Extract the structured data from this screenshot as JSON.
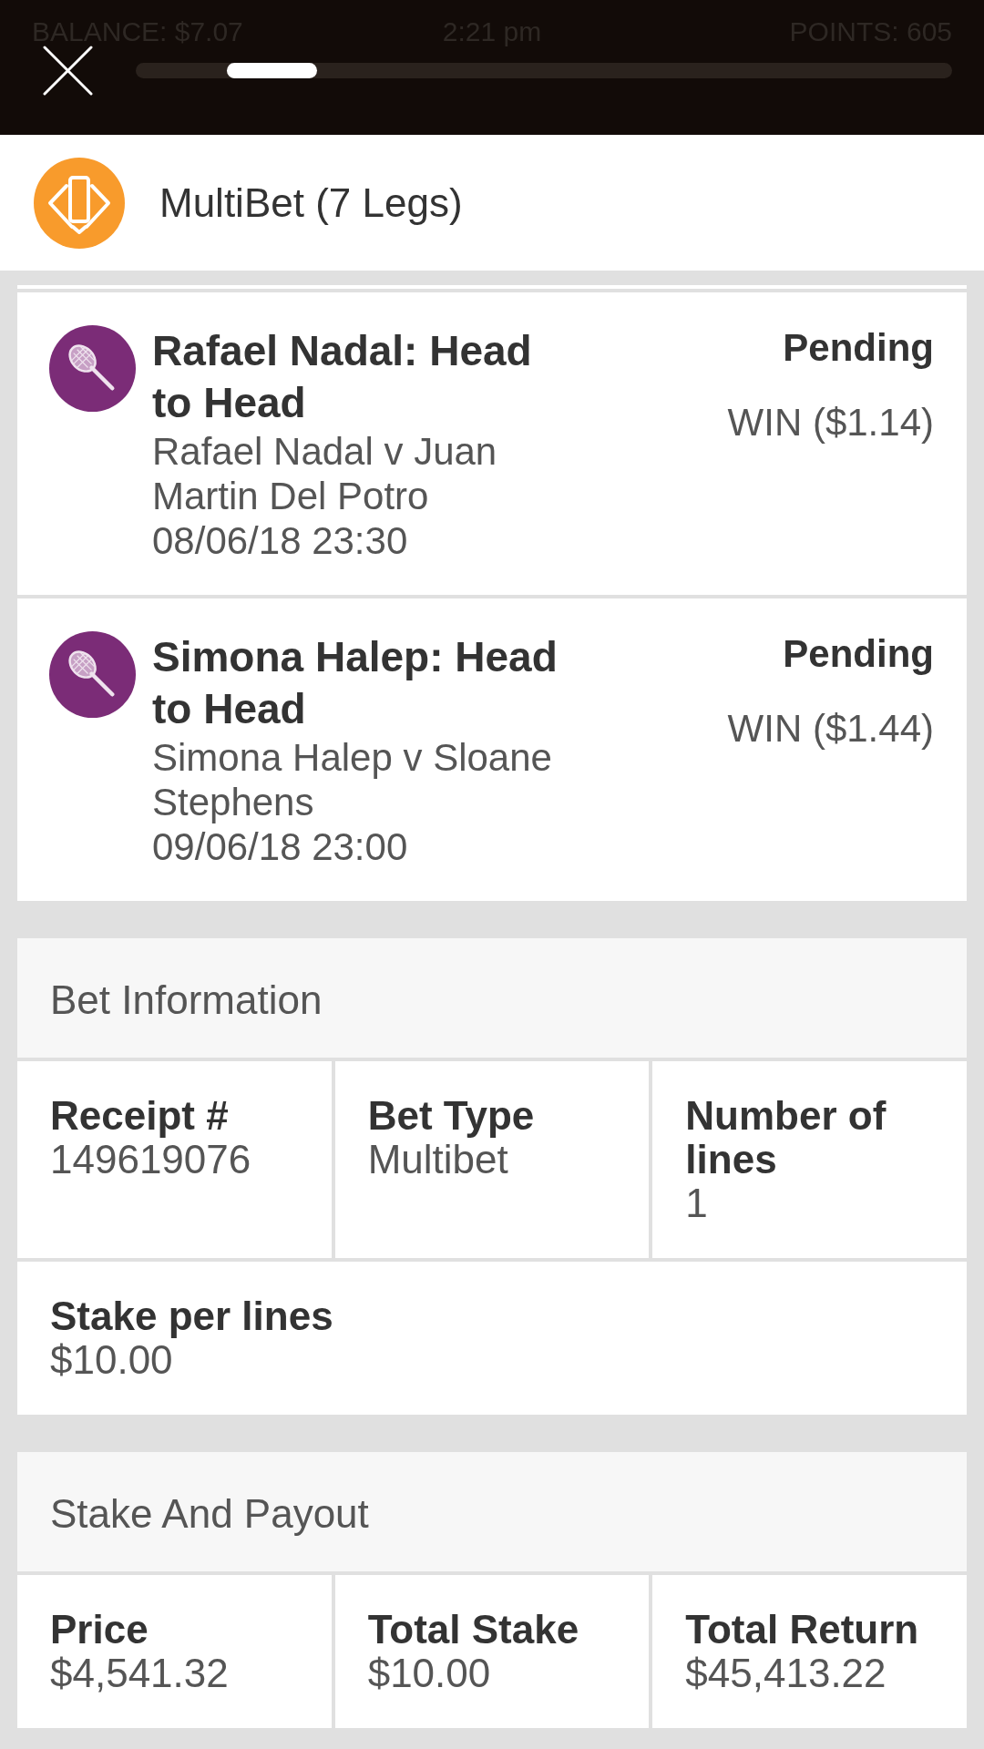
{
  "status_bar": {
    "balance": "BALANCE: $7.07",
    "time": "2:21 pm",
    "points": "POINTS: 605"
  },
  "sheet": {
    "title": "MultiBet (7 Legs)"
  },
  "legs": [
    {
      "title": "Rafael Nadal: Head to Head",
      "event": "Rafael Nadal v Juan Martin Del Potro",
      "date": "08/06/18 23:30",
      "status": "Pending",
      "result": "WIN ($1.14)"
    },
    {
      "title": "Simona Halep: Head to Head",
      "event": "Simona Halep v Sloane Stephens",
      "date": "09/06/18 23:00",
      "status": "Pending",
      "result": "WIN ($1.44)"
    }
  ],
  "sections": [
    {
      "title": "Bet Information",
      "rows": [
        [
          {
            "label": "Receipt #",
            "value": "149619076"
          },
          {
            "label": "Bet Type",
            "value": "Multibet"
          },
          {
            "label": "Number of lines",
            "value": "1"
          }
        ],
        [
          {
            "label": "Stake per lines",
            "value": "$10.00"
          }
        ]
      ]
    },
    {
      "title": "Stake And Payout",
      "rows": [
        [
          {
            "label": "Price",
            "value": "$4,541.32"
          },
          {
            "label": "Total Stake",
            "value": "$10.00"
          },
          {
            "label": "Total Return",
            "value": "$45,413.22"
          }
        ]
      ]
    }
  ]
}
